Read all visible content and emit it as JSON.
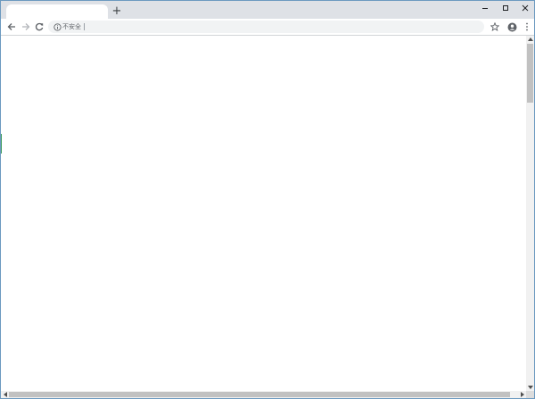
{
  "browser": {
    "tab": {
      "title": ""
    },
    "new_tab_label": "+",
    "omnibox": {
      "security_label": "不安全",
      "url": ""
    }
  },
  "icons": {
    "minimize": "minimize-icon",
    "maximize": "maximize-icon",
    "close": "close-icon",
    "back": "back-arrow-icon",
    "forward": "forward-arrow-icon",
    "reload": "reload-icon",
    "info": "info-icon",
    "bookmark": "star-icon",
    "account": "account-icon",
    "menu": "kebab-menu-icon"
  },
  "colors": {
    "tabstrip": "#dee1e6",
    "omnibox": "#f1f3f4",
    "window_border": "#6c9ac0",
    "accent_green": "#3d9b5c"
  }
}
